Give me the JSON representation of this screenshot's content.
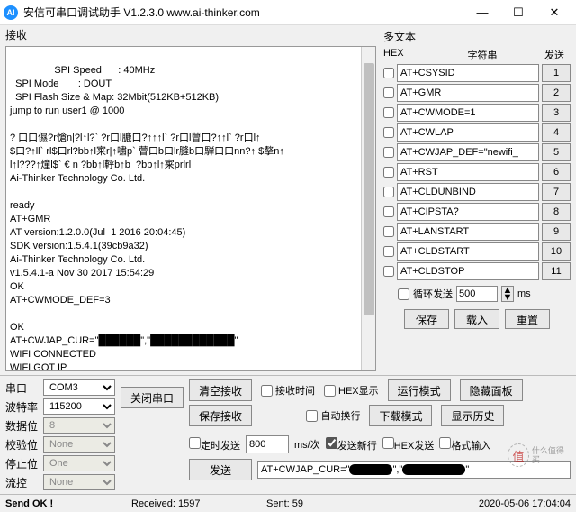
{
  "title": "安信可串口调试助手 V1.2.3.0   www.ai-thinker.com",
  "recv_label": "接收",
  "recv_text": "  SPI Speed      : 40MHz\n  SPI Mode       : DOUT\n  SPI Flash Size & Map: 32Mbit(512KB+512KB)\njump to run user1 @ 1000\n\n? 口口儑?r愴n|?l↑l?` ?r口l膔口?↑↑↑l` ?r口l萺口?↑↑l` ?r口l↑\n$口?↑ll` rl$口rl?bb↑l宷r|↑嘯p` 萺口b口lr膖b口騨口口nn?↑ $摮n↑\nl↑l???↑燑l$` € n ?bb↑l軤b↑b  ?bb↑l↑宷prlrl\nAi-Thinker Technology Co. Ltd.\n\nready\nAT+GMR\nAT version:1.2.0.0(Jul  1 2016 20:04:45)\nSDK version:1.5.4.1(39cb9a32)\nAi-Thinker Technology Co. Ltd.\nv1.5.4.1-a Nov 30 2017 15:54:29\nOK\nAT+CWMODE_DEF=3\n\nOK\nAT+CWJAP_CUR=\"██████\",\"████████████\"\nWIFI CONNECTED\nWIFI GOT IP\n\nOK",
  "multi_label": "多文本",
  "col_hex": "HEX",
  "col_str": "字符串",
  "col_send": "发送",
  "rows": [
    {
      "txt": "AT+CSYSID",
      "n": "1"
    },
    {
      "txt": "AT+GMR",
      "n": "2"
    },
    {
      "txt": "AT+CWMODE=1",
      "n": "3"
    },
    {
      "txt": "AT+CWLAP",
      "n": "4"
    },
    {
      "txt": "AT+CWJAP_DEF=\"newifi_",
      "n": "5"
    },
    {
      "txt": "AT+RST",
      "n": "6"
    },
    {
      "txt": "AT+CLDUNBIND",
      "n": "7"
    },
    {
      "txt": "AT+CIPSTA?",
      "n": "8"
    },
    {
      "txt": "AT+LANSTART",
      "n": "9"
    },
    {
      "txt": "AT+CLDSTART",
      "n": "10"
    },
    {
      "txt": "AT+CLDSTOP",
      "n": "11"
    }
  ],
  "loop_label": "循环发送",
  "loop_val": "500",
  "loop_unit": "ms",
  "btn_save": "保存",
  "btn_load": "载入",
  "btn_reset": "重置",
  "port": {
    "l_port": "串口",
    "v_port": "COM3",
    "l_baud": "波特率",
    "v_baud": "115200",
    "l_data": "数据位",
    "v_data": "8",
    "l_check": "校验位",
    "v_check": "None",
    "l_stop": "停止位",
    "v_stop": "One",
    "l_flow": "流控",
    "v_flow": "None"
  },
  "btn_close": "关闭串口",
  "btn_clear": "清空接收",
  "btn_savefile": "保存接收",
  "chk_time": "接收时间",
  "chk_hexshow": "HEX显示",
  "chk_autowrap": "自动换行",
  "btn_runmode": "运行模式",
  "btn_dlmode": "下载模式",
  "btn_hide": "隐藏面板",
  "btn_history": "显示历史",
  "chk_timed": "定时发送",
  "timed_val": "800",
  "timed_unit": "ms/次",
  "chk_newline": "发送新行",
  "chk_hexsend": "HEX发送",
  "chk_format": "格式输入",
  "btn_send": "发送",
  "send_text": "AT+CWJAP_CUR=\"",
  "status": {
    "ok": "Send OK !",
    "recv": "Received: 1597",
    "sent": "Sent: 59",
    "time": "2020-05-06 17:04:04"
  },
  "watermark": {
    "c": "值",
    "t": "什么值得买"
  }
}
